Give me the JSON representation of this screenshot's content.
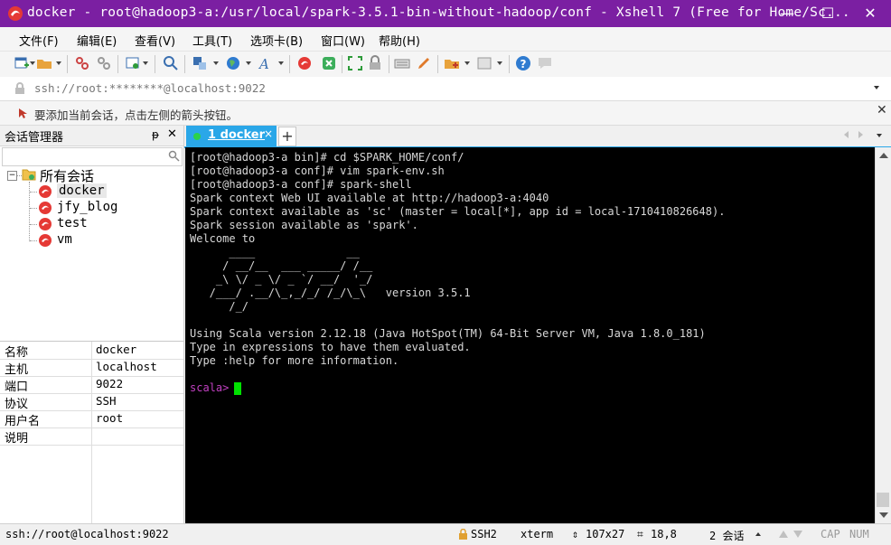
{
  "window": {
    "title": "docker - root@hadoop3-a:/usr/local/spark-3.5.1-bin-without-hadoop/conf - Xshell 7 (Free for Home/Sc...",
    "minimize": "—",
    "maximize": "☐",
    "close": "✕"
  },
  "menu": [
    "文件(F)",
    "编辑(E)",
    "查看(V)",
    "工具(T)",
    "选项卡(B)",
    "窗口(W)",
    "帮助(H)"
  ],
  "address_bar": {
    "value": "ssh://root:********@localhost:9022"
  },
  "info_bar": {
    "text": "要添加当前会话，点击左侧的箭头按钮。"
  },
  "session_manager": {
    "title": "会话管理器",
    "pin": "ᵽ",
    "close": "✕",
    "root_label": "所有会话",
    "sessions": [
      "docker",
      "jfy_blog",
      "test",
      "vm"
    ]
  },
  "properties": [
    {
      "key": "名称",
      "value": "docker"
    },
    {
      "key": "主机",
      "value": "localhost"
    },
    {
      "key": "端口",
      "value": "9022"
    },
    {
      "key": "协议",
      "value": "SSH"
    },
    {
      "key": "用户名",
      "value": "root"
    },
    {
      "key": "说明",
      "value": ""
    }
  ],
  "tabs": [
    {
      "label": "1 docker",
      "close": "×",
      "active": true
    }
  ],
  "tab_add": "+",
  "terminal": {
    "lines": [
      "[root@hadoop3-a bin]# cd $SPARK_HOME/conf/",
      "[root@hadoop3-a conf]# vim spark-env.sh",
      "[root@hadoop3-a conf]# spark-shell",
      "Spark context Web UI available at http://hadoop3-a:4040",
      "Spark context available as 'sc' (master = local[*], app id = local-1710410826648).",
      "Spark session available as 'spark'.",
      "Welcome to",
      "      ____              __",
      "     / __/__  ___ _____/ /__",
      "    _\\ \\/ _ \\/ _ `/ __/  '_/",
      "   /___/ .__/\\_,_/_/ /_/\\_\\   version 3.5.1",
      "      /_/",
      "",
      "Using Scala version 2.12.18 (Java HotSpot(TM) 64-Bit Server VM, Java 1.8.0_181)",
      "Type in expressions to have them evaluated.",
      "Type :help for more information.",
      "",
      ""
    ],
    "prompt": "scala> "
  },
  "status": {
    "connection": "ssh://root@localhost:9022",
    "protocol": "SSH2",
    "term": "xterm",
    "size": "107x27",
    "cursor": "18,8",
    "sessions": "2 会话",
    "cap": "CAP",
    "num": "NUM"
  },
  "colors": {
    "titlebar": "#7b1fa2",
    "tab_active": "#2aa7e8",
    "terminal_bg": "#000000",
    "terminal_fg": "#d8d8d8",
    "prompt": "#c040c0",
    "cursor": "#00e000"
  }
}
